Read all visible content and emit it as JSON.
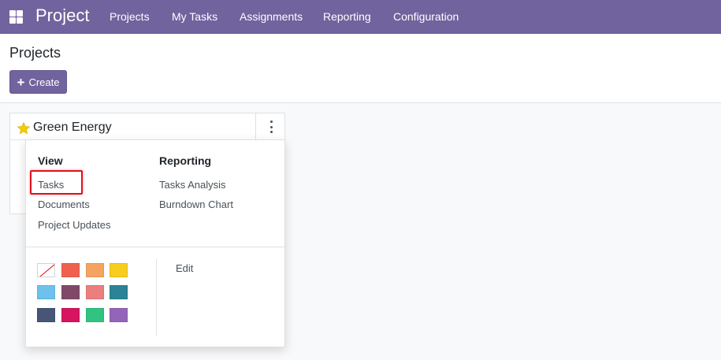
{
  "navbar": {
    "brand": "Project",
    "menu": [
      {
        "label": "Projects"
      },
      {
        "label": "My Tasks"
      },
      {
        "label": "Assignments"
      },
      {
        "label": "Reporting"
      },
      {
        "label": "Configuration"
      }
    ]
  },
  "control_panel": {
    "title": "Projects",
    "create_label": "Create"
  },
  "card": {
    "title": "Green Energy",
    "favorite": true
  },
  "dropdown": {
    "view_header": "View",
    "view_items": [
      {
        "label": "Tasks",
        "highlighted": true
      },
      {
        "label": "Documents"
      },
      {
        "label": "Project Updates"
      }
    ],
    "reporting_header": "Reporting",
    "reporting_items": [
      {
        "label": "Tasks Analysis"
      },
      {
        "label": "Burndown Chart"
      }
    ],
    "edit_label": "Edit",
    "colors": [
      "none",
      "#f06050",
      "#f4a460",
      "#f7cd1f",
      "#6cc1ed",
      "#814968",
      "#eb7e7f",
      "#2c8397",
      "#475577",
      "#d6145f",
      "#30c381",
      "#9365b8"
    ]
  },
  "theme": {
    "navbar_bg": "#71639e",
    "star_color": "#f3cc00",
    "highlight_border": "#e0101e"
  }
}
